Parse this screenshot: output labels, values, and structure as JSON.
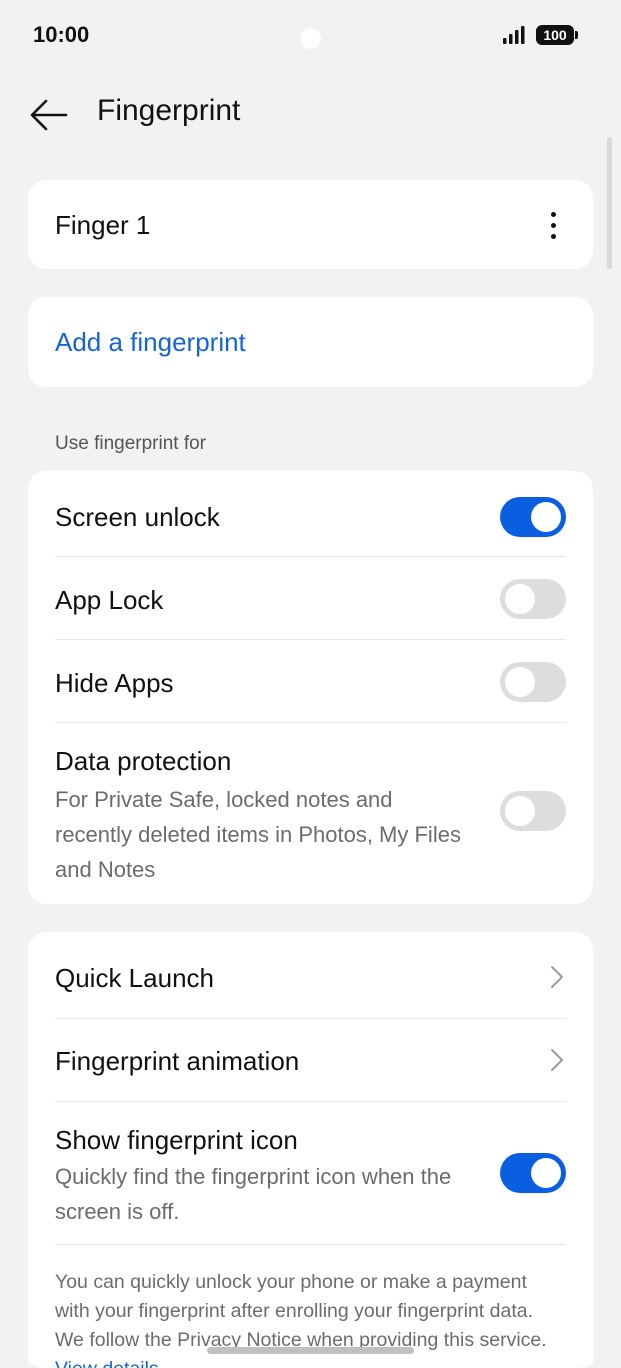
{
  "status_bar": {
    "time": "10:00",
    "battery": "100",
    "icons": [
      "signal-icon",
      "battery-icon"
    ]
  },
  "header": {
    "title": "Fingerprint",
    "back_icon": "arrow-left-icon"
  },
  "fingers": [
    {
      "label": "Finger 1",
      "menu_icon": "more-vertical-icon"
    }
  ],
  "add_fingerprint": {
    "label": "Add a fingerprint"
  },
  "use_for": {
    "section_label": "Use fingerprint for",
    "items": [
      {
        "label": "Screen unlock",
        "enabled": true
      },
      {
        "label": "App Lock",
        "enabled": false
      },
      {
        "label": "Hide Apps",
        "enabled": false
      },
      {
        "label": "Data protection",
        "description": "For Private Safe, locked notes and recently deleted items in Photos, My Files and Notes",
        "enabled": false
      }
    ]
  },
  "more": {
    "items": [
      {
        "label": "Quick Launch",
        "icon": "chevron-right-icon"
      },
      {
        "label": "Fingerprint animation",
        "icon": "chevron-right-icon"
      },
      {
        "label": "Show fingerprint icon",
        "description": "Quickly find the fingerprint icon when the screen is off.",
        "enabled": true
      }
    ]
  },
  "footer": {
    "text": "You can quickly unlock your phone or make a payment with your fingerprint after enrolling your fingerprint data. We follow the Privacy Notice when providing this service.",
    "link": "View details"
  },
  "colors": {
    "accent": "#0a5fe0",
    "link": "#1565d8",
    "background": "#f1f2f4",
    "card": "#ffffff"
  }
}
